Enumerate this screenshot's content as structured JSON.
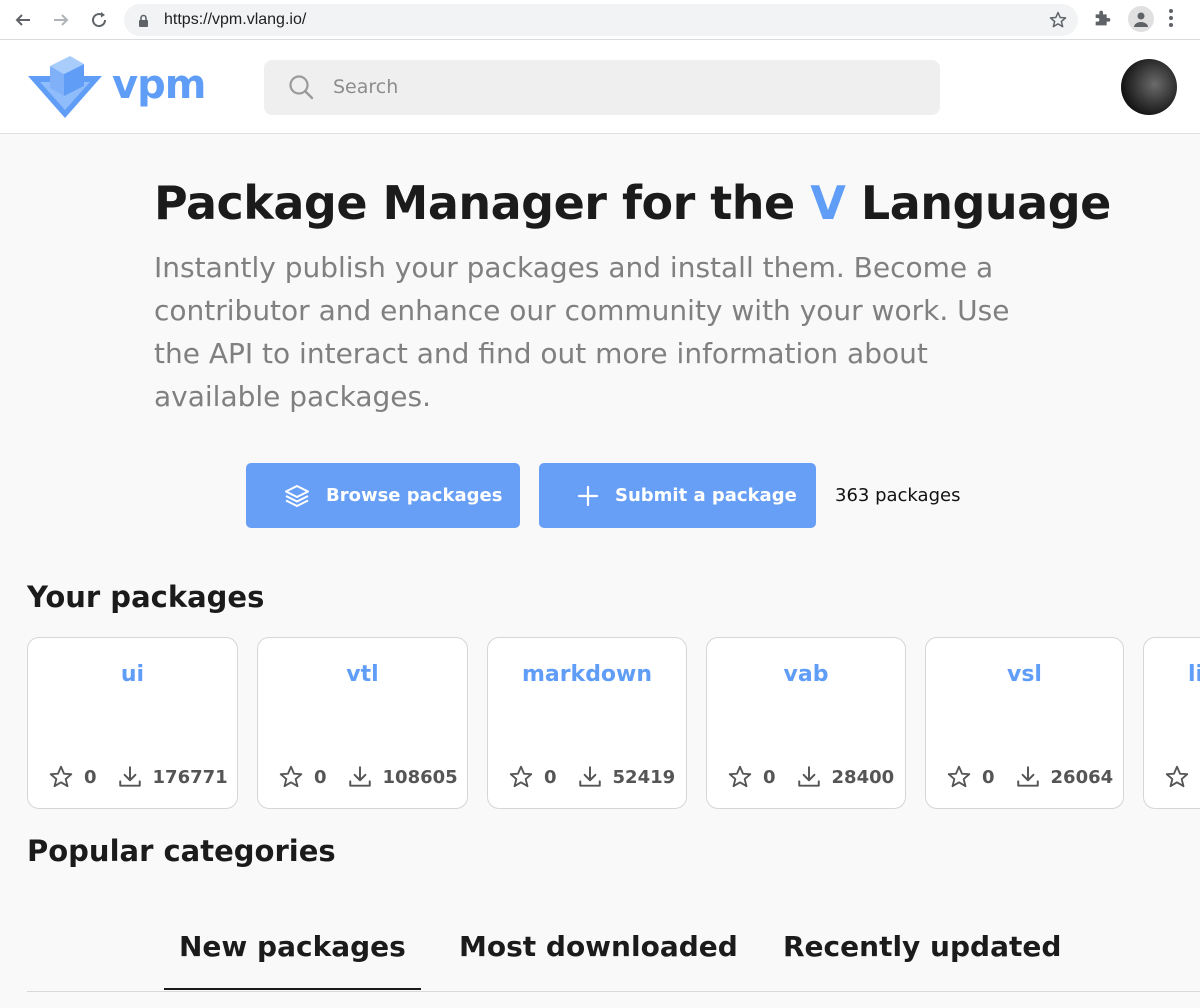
{
  "browser": {
    "url": "https://vpm.vlang.io/"
  },
  "header": {
    "logo_text": "vpm",
    "search_placeholder": "Search"
  },
  "hero": {
    "title_before": "Package Manager for the ",
    "title_accent": "V",
    "title_after": " Language",
    "description": "Instantly publish your packages and install them. Become a contributor and enhance our community with your work. Use the API to interact and find out more information about available packages.",
    "browse_label": "Browse packages",
    "submit_label": "Submit a package",
    "package_count": "363 packages"
  },
  "your_packages": {
    "title": "Your packages",
    "items": [
      {
        "name": "ui",
        "stars": "0",
        "downloads": "176771"
      },
      {
        "name": "vtl",
        "stars": "0",
        "downloads": "108605"
      },
      {
        "name": "markdown",
        "stars": "0",
        "downloads": "52419"
      },
      {
        "name": "vab",
        "stars": "0",
        "downloads": "28400"
      },
      {
        "name": "vsl",
        "stars": "0",
        "downloads": "26064"
      },
      {
        "name": "li",
        "stars": "",
        "downloads": ""
      }
    ]
  },
  "popular": {
    "title": "Popular categories"
  },
  "tabs": [
    {
      "label": "New packages",
      "active": true
    },
    {
      "label": "Most downloaded",
      "active": false
    },
    {
      "label": "Recently updated",
      "active": false
    }
  ],
  "colors": {
    "accent": "#5f9df7",
    "button": "#679ff6"
  }
}
